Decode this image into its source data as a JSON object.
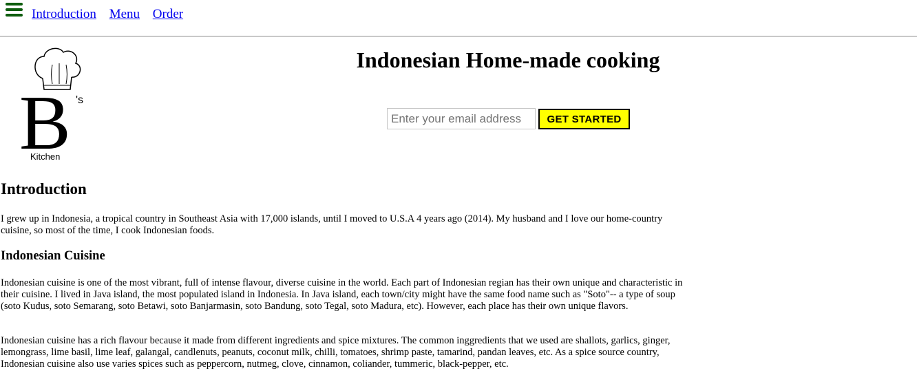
{
  "nav": {
    "menu_icon": "hamburger-menu-icon",
    "links": [
      "Introduction",
      "Menu",
      "Order"
    ]
  },
  "logo": {
    "letter": "B",
    "suffix": "'s",
    "caption": "Kitchen",
    "icon": "chef-hat-icon"
  },
  "header": {
    "title": "Indonesian Home-made cooking"
  },
  "signup": {
    "placeholder": "Enter your email address",
    "button_label": "GET STARTED",
    "button_color": "#ffff00"
  },
  "content": {
    "intro_heading": "Introduction",
    "intro_paragraph": "I grew up in Indonesia, a tropical country in Southeast Asia with 17,000 islands, until I moved to U.S.A 4 years ago (2014). My husband and I love our home-country cuisine, so most of the time, I cook Indonesian foods.",
    "cuisine_heading": "Indonesian Cuisine",
    "cuisine_paragraph_1": "Indonesian cuisine is one of the most vibrant, full of intense flavour, diverse cuisine in the world. Each part of Indonesian regian has their own unique and characteristic in their cuisine. I lived in Java island, the most populated island in Indonesia. In Java island, each town/city might have the same food name such as \"Soto\"-- a type of soup (soto Kudus, soto Semarang, soto Betawi, soto Banjarmasin, soto Bandung, soto Tegal, soto Madura, etc). However, each place has their own unique flavors.",
    "cuisine_paragraph_2": "Indonesian cuisine has a rich flavour because it made from different ingredients and spice mixtures. The common inggredients that we used are shallots, garlics, ginger, lemongrass, lime basil, lime leaf, galangal, candlenuts, peanuts, coconut milk, chilli, tomatoes, shrimp paste, tamarind, pandan leaves, etc. As a spice source country, Indonesian cuisine also use varies spices such as peppercorn, nutmeg, clove, cinnamon, coliander, tummeric, black-pepper, etc."
  },
  "colors": {
    "hamburger": "#0e5d0e",
    "link": "#0000ee",
    "divider": "#888888"
  }
}
